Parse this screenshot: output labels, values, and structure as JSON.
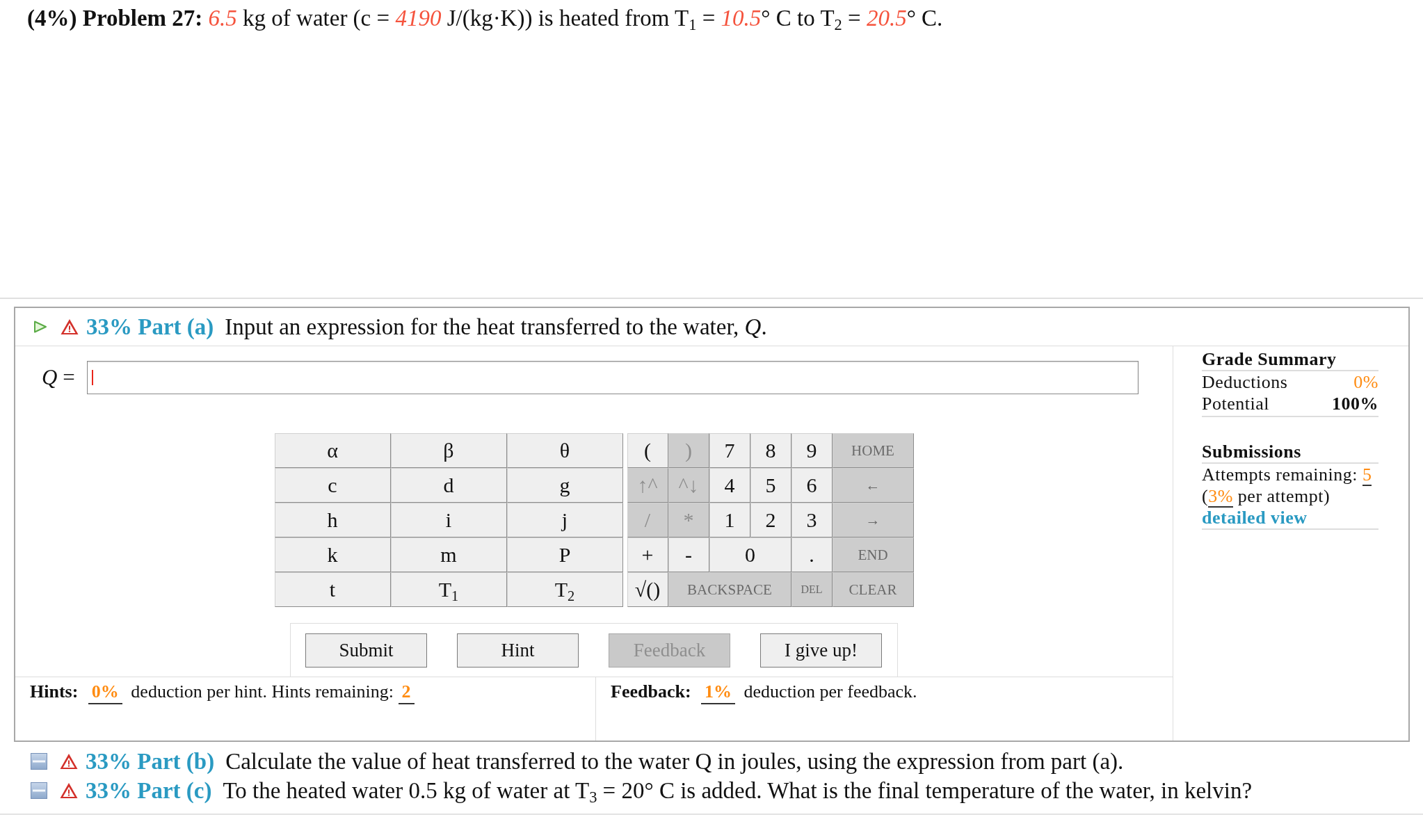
{
  "problem": {
    "statement": "**(4%) Problem 27:** *6.5* kg of water (c = *4190* J/(kg·K)) is heated from T$_{1}$ = *10.5*° C to T$_{2}$ = *20.5*° C."
  },
  "parts": [
    {
      "heading": "33% Part (a)",
      "prompt": "Input an expression for the heat transferred to the water, *Q*.",
      "expanded": true,
      "answer": {
        "label": "*Q* =",
        "focused": true
      },
      "keypad": {
        "symbols": [
          {
            "label": "α",
            "disabled": false
          },
          {
            "label": "β",
            "disabled": false
          },
          {
            "label": "θ",
            "disabled": false
          },
          {
            "label": "c",
            "disabled": false
          },
          {
            "label": "d",
            "disabled": false
          },
          {
            "label": "g",
            "disabled": false
          },
          {
            "label": "h",
            "disabled": false
          },
          {
            "label": "i",
            "disabled": false
          },
          {
            "label": "j",
            "disabled": false
          },
          {
            "label": "k",
            "disabled": false
          },
          {
            "label": "m",
            "disabled": false
          },
          {
            "label": "P",
            "disabled": false
          },
          {
            "label": "t",
            "disabled": false
          },
          {
            "label": "T$_{1}$",
            "disabled": false
          },
          {
            "label": "T$_{2}$",
            "disabled": false
          }
        ],
        "operator_rows": [
          {
            "keys": [
              {
                "label": "(",
                "disabled": false,
                "kind": "char"
              },
              {
                "label": ")",
                "disabled": true,
                "kind": "char"
              },
              {
                "label": "7",
                "disabled": false,
                "kind": "char"
              },
              {
                "label": "8",
                "disabled": false,
                "kind": "char"
              },
              {
                "label": "9",
                "disabled": false,
                "kind": "char"
              },
              {
                "label": "HOME",
                "disabled": true,
                "kind": "command"
              }
            ]
          },
          {
            "keys": [
              {
                "label": "↑^",
                "disabled": true,
                "kind": "char"
              },
              {
                "label": "^↓",
                "disabled": true,
                "kind": "char"
              },
              {
                "label": "4",
                "disabled": false,
                "kind": "char"
              },
              {
                "label": "5",
                "disabled": false,
                "kind": "char"
              },
              {
                "label": "6",
                "disabled": false,
                "kind": "char"
              },
              {
                "label": "←",
                "disabled": true,
                "kind": "command"
              }
            ]
          },
          {
            "keys": [
              {
                "label": "/",
                "disabled": true,
                "kind": "char"
              },
              {
                "label": "*",
                "disabled": true,
                "kind": "char"
              },
              {
                "label": "1",
                "disabled": false,
                "kind": "char"
              },
              {
                "label": "2",
                "disabled": false,
                "kind": "char"
              },
              {
                "label": "3",
                "disabled": false,
                "kind": "char"
              },
              {
                "label": "→",
                "disabled": true,
                "kind": "command"
              }
            ]
          },
          {
            "keys": [
              {
                "label": "+",
                "disabled": false,
                "kind": "char"
              },
              {
                "label": "-",
                "disabled": false,
                "kind": "char"
              },
              {
                "label": "0",
                "disabled": false,
                "kind": "wide-char"
              },
              {
                "label": ".",
                "disabled": false,
                "kind": "char"
              },
              {
                "label": "END",
                "disabled": true,
                "kind": "command"
              }
            ]
          },
          {
            "keys": [
              {
                "label": "√()",
                "disabled": false,
                "kind": "char"
              },
              {
                "label": "BACKSPACE",
                "disabled": true,
                "kind": "wide-command"
              },
              {
                "label": "DEL",
                "disabled": true,
                "kind": "small-command"
              },
              {
                "label": "CLEAR",
                "disabled": true,
                "kind": "command"
              }
            ]
          }
        ]
      },
      "buttons": [
        {
          "label": "Submit",
          "disabled": false
        },
        {
          "label": "Hint",
          "disabled": false
        },
        {
          "label": "Feedback",
          "disabled": true
        },
        {
          "label": "I give up!",
          "disabled": false
        }
      ],
      "hints": {
        "label": "Hints:",
        "deduction": "0%",
        "text": "deduction per hint. Hints remaining:",
        "remaining": "2"
      },
      "feedback": {
        "label": "Feedback:",
        "deduction": "1%",
        "text": "deduction per feedback."
      },
      "grade_summary": {
        "title": "Grade Summary",
        "rows": [
          {
            "label": "Deductions",
            "value": "0%",
            "kind": "deduction"
          },
          {
            "label": "Potential",
            "value": "100%",
            "kind": "total"
          }
        ]
      },
      "submissions": {
        "title": "Submissions",
        "attempts_label": "Attempts remaining:",
        "attempts": "5",
        "rate_note": "(**3%** per attempt)",
        "link": "detailed view"
      }
    },
    {
      "heading": "33% Part (b)",
      "prompt": "Calculate the value of heat transferred to the water Q in joules, using the expression from part (a).",
      "expanded": false
    },
    {
      "heading": "33% Part (c)",
      "prompt": "To the heated water 0.5 kg of water at T$_{3}$ = 20° C is added. What is the final temperature of the water, in kelvin?",
      "expanded": false
    }
  ]
}
